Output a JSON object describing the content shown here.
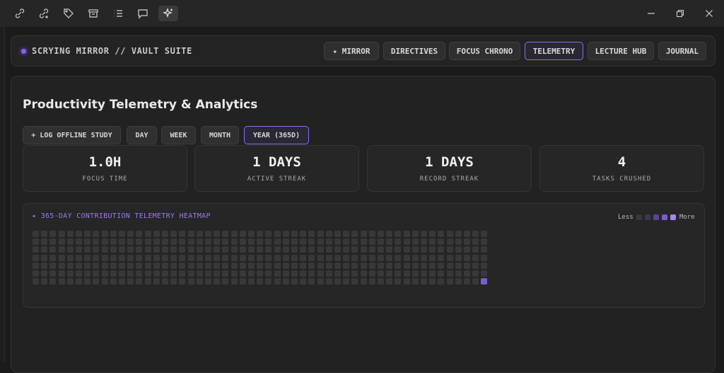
{
  "titlebar": {
    "icons": [
      "link-edit-icon",
      "link-add-icon",
      "tag-icon",
      "archive-icon",
      "list-icon",
      "chat-icon",
      "sparkle-icon"
    ],
    "window_controls": [
      "minimize-icon",
      "restore-icon",
      "close-icon"
    ]
  },
  "nav": {
    "brand": "SCRYING MIRROR // VAULT SUITE",
    "buttons": [
      "✦ MIRROR",
      "DIRECTIVES",
      "FOCUS CHRONO",
      "TELEMETRY",
      "LECTURE HUB",
      "JOURNAL"
    ],
    "active": "TELEMETRY"
  },
  "page": {
    "title": "Productivity Telemetry & Analytics",
    "log_button": "+ LOG OFFLINE STUDY",
    "ranges": [
      "DAY",
      "WEEK",
      "MONTH",
      "YEAR (365D)"
    ],
    "active_range": "YEAR (365D)"
  },
  "stats": [
    {
      "value": "1.0H",
      "label": "FOCUS TIME"
    },
    {
      "value": "1 DAYS",
      "label": "ACTIVE STREAK"
    },
    {
      "value": "1 DAYS",
      "label": "RECORD STREAK"
    },
    {
      "value": "4",
      "label": "TASKS CRUSHED"
    }
  ],
  "heatmap": {
    "title": "✦ 365-DAY CONTRIBUTION TELEMETRY HEATMAP",
    "legend_less": "Less",
    "legend_more": "More",
    "colors": [
      "#383838",
      "#3c3559",
      "#5a4594",
      "#7b5cd1",
      "#a686f0"
    ],
    "weeks": 53,
    "days_per_week": 7,
    "active_cells": [
      {
        "week": 52,
        "day": 6,
        "level": 3
      }
    ]
  }
}
